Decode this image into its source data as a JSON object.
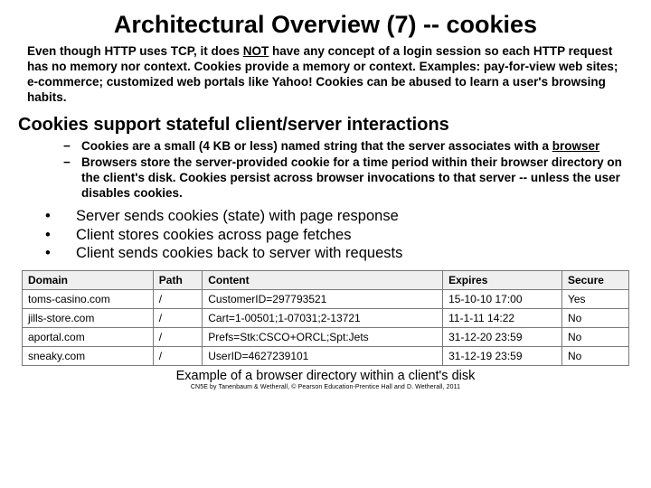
{
  "title": "Architectural Overview (7) -- cookies",
  "intro_pre": "Even though HTTP uses TCP, it does ",
  "intro_not": "NOT",
  "intro_post": " have any concept of a login session so each HTTP request has no memory nor context. Cookies provide a memory or context. Examples: pay-for-view web sites; e-commerce; customized web portals like Yahoo! Cookies can be abused to learn a user's browsing habits.",
  "subhead": "Cookies support stateful client/server interactions",
  "dash1_pre": "Cookies are a small (4 KB or less) named string that the server associates with a ",
  "dash1_u": "browser",
  "dash2": "Browsers store the server-provided cookie for a time period within their browser directory on the client's disk.  Cookies persist across browser invocations to that server -- unless the user disables cookies.",
  "bullet1": "Server sends cookies (state) with page response",
  "bullet2": "Client stores cookies across page fetches",
  "bullet3": "Client sends cookies back to server with requests",
  "table": {
    "headers": [
      "Domain",
      "Path",
      "Content",
      "Expires",
      "Secure"
    ],
    "rows": [
      [
        "toms-casino.com",
        "/",
        "CustomerID=297793521",
        "15-10-10 17:00",
        "Yes"
      ],
      [
        "jills-store.com",
        "/",
        "Cart=1-00501;1-07031;2-13721",
        "11-1-11 14:22",
        "No"
      ],
      [
        "aportal.com",
        "/",
        "Prefs=Stk:CSCO+ORCL;Spt:Jets",
        "31-12-20 23:59",
        "No"
      ],
      [
        "sneaky.com",
        "/",
        "UserID=4627239101",
        "31-12-19 23:59",
        "No"
      ]
    ]
  },
  "caption": "Example of a browser directory within a client's disk",
  "credit": "CN5E by Tanenbaum & Wetherall, © Pearson Education-Prentice Hall and D. Wetherall, 2011",
  "dash_char": "−",
  "dot_char": "•"
}
